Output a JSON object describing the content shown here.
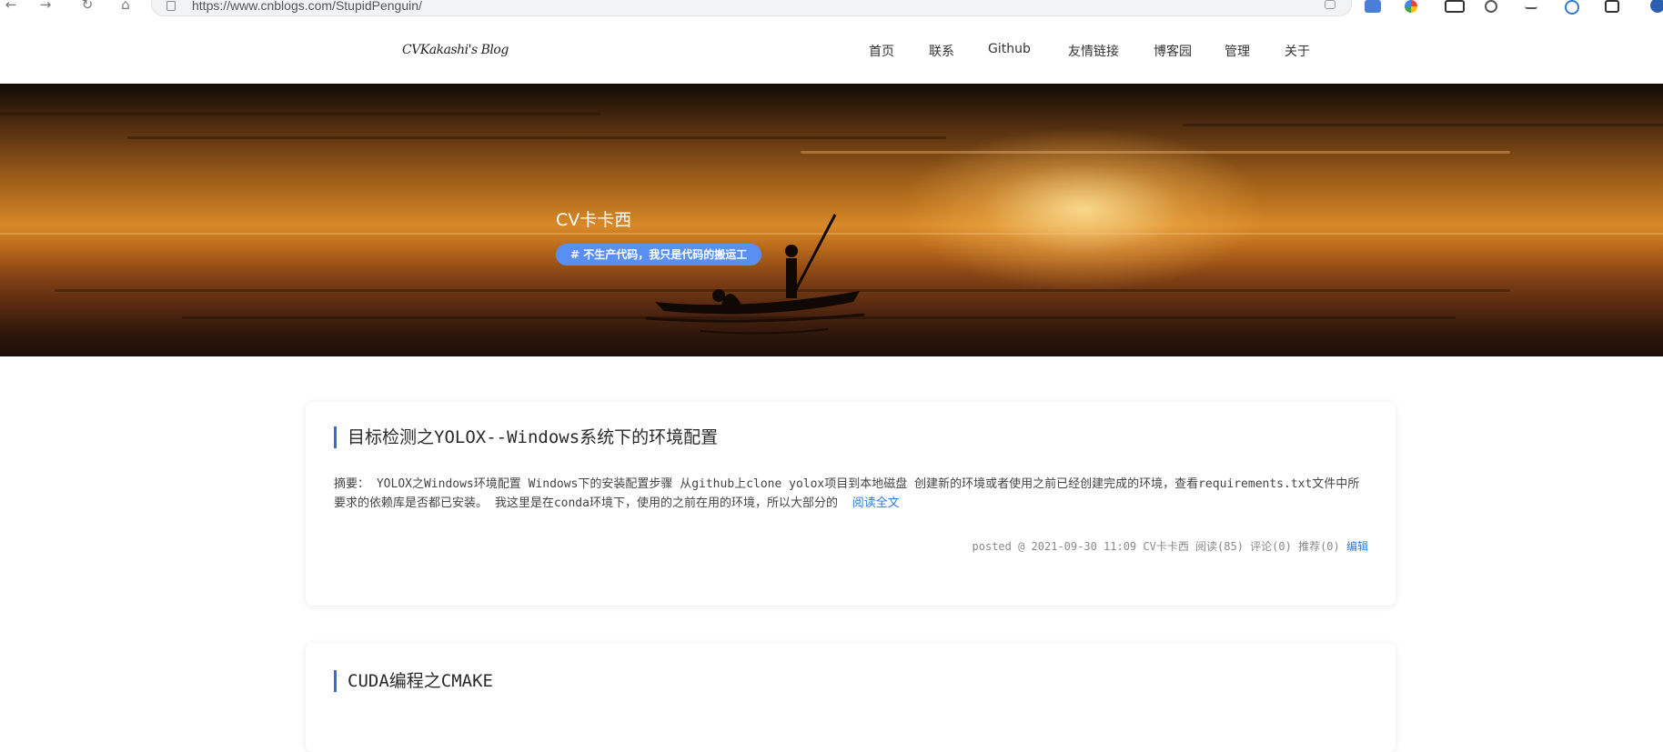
{
  "browser": {
    "back_icon": "←",
    "forward_icon": "→",
    "reload_icon": "↻",
    "home_icon": "⌂",
    "url": "https://www.cnblogs.com/StupidPenguin/"
  },
  "header": {
    "logo": "CVKakashi's Blog",
    "nav": [
      "首页",
      "联系",
      "Github",
      "友情链接",
      "博客园",
      "管理",
      "关于"
    ]
  },
  "banner": {
    "title": "CV卡卡西",
    "slogan": "# 不生产代码，我只是代码的搬运工"
  },
  "posts": [
    {
      "title": "目标检测之YOLOX--Windows系统下的环境配置",
      "summary_prefix": "摘要：",
      "summary": "YOLOX之Windows环境配置 Windows下的安装配置步骤 从github上clone yolox项目到本地磁盘 创建新的环境或者使用之前已经创建完成的环境，查看requirements.txt文件中所要求的依赖库是否都已安装。 我这里是在conda环境下，使用的之前在用的环境，所以大部分的",
      "read_more": "阅读全文",
      "footer_meta": "posted @ 2021-09-30 11:09 CV卡卡西 阅读(85) 评论(0) 推荐(0)",
      "edit": "编辑"
    },
    {
      "title": "CUDA编程之CMAKE"
    }
  ],
  "colors": {
    "accent": "#2f6fd1",
    "link": "#2b7bd7",
    "slogan_bg": "#5a8ff2"
  }
}
